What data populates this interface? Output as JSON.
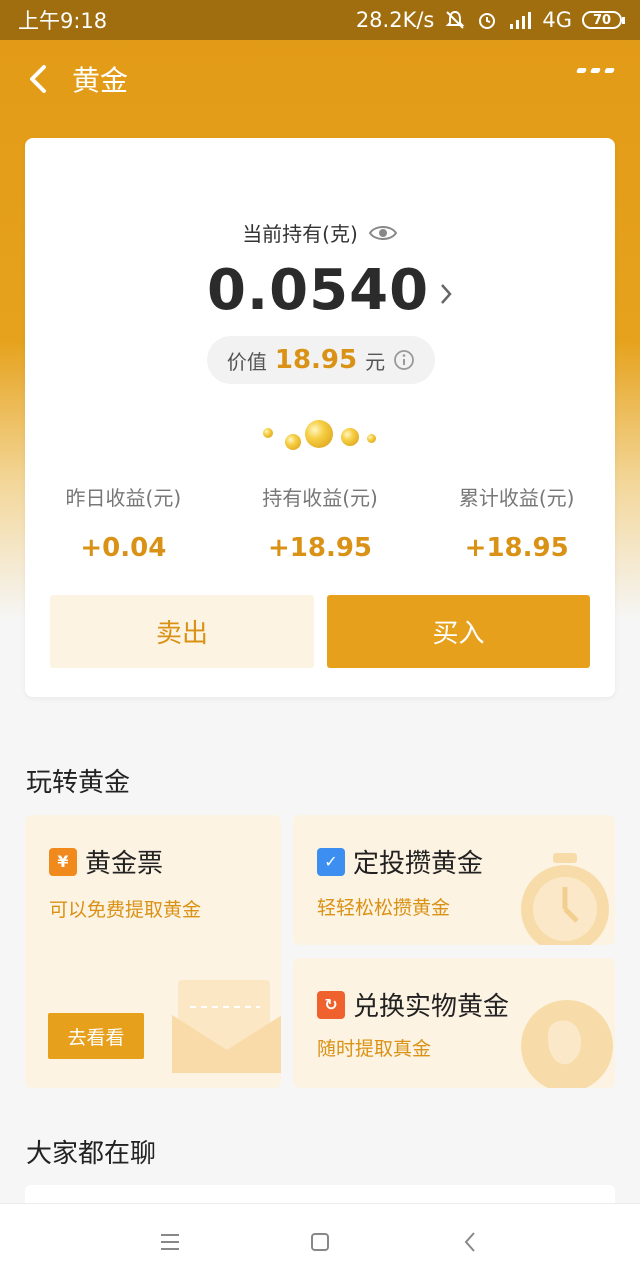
{
  "status_bar": {
    "time": "上午9:18",
    "network_speed": "28.2K/s",
    "network_type": "4G",
    "battery": "70",
    "icons": [
      "mute-bell-icon",
      "alarm-icon",
      "signal-icon"
    ]
  },
  "nav": {
    "title": "黄金",
    "back_icon": "back-chevron-icon",
    "more_icon": "more-dots-icon"
  },
  "holding": {
    "label": "当前持有(克)",
    "amount": "0.0540",
    "value_label": "价值",
    "value": "18.95",
    "value_unit": "元",
    "stats": [
      {
        "label": "昨日收益(元)",
        "value": "+0.04"
      },
      {
        "label": "持有收益(元)",
        "value": "+18.95"
      },
      {
        "label": "累计收益(元)",
        "value": "+18.95"
      }
    ],
    "sell_label": "卖出",
    "buy_label": "买入"
  },
  "play_section": {
    "title": "玩转黄金",
    "tiles": [
      {
        "title": "黄金票",
        "subtitle": "可以免费提取黄金",
        "button": "去看看",
        "icon": "ticket-icon",
        "icon_glyph": "¥"
      },
      {
        "title": "定投攒黄金",
        "subtitle": "轻轻松松攒黄金",
        "icon": "calendar-icon",
        "icon_glyph": "✓"
      },
      {
        "title": "兑换实物黄金",
        "subtitle": "随时提取真金",
        "icon": "exchange-icon",
        "icon_glyph": "↻"
      }
    ]
  },
  "chat_section": {
    "title": "大家都在聊"
  },
  "colors": {
    "accent": "#e6a01b",
    "gold_text": "#d99215",
    "tile_bg": "#fdf3e3"
  }
}
